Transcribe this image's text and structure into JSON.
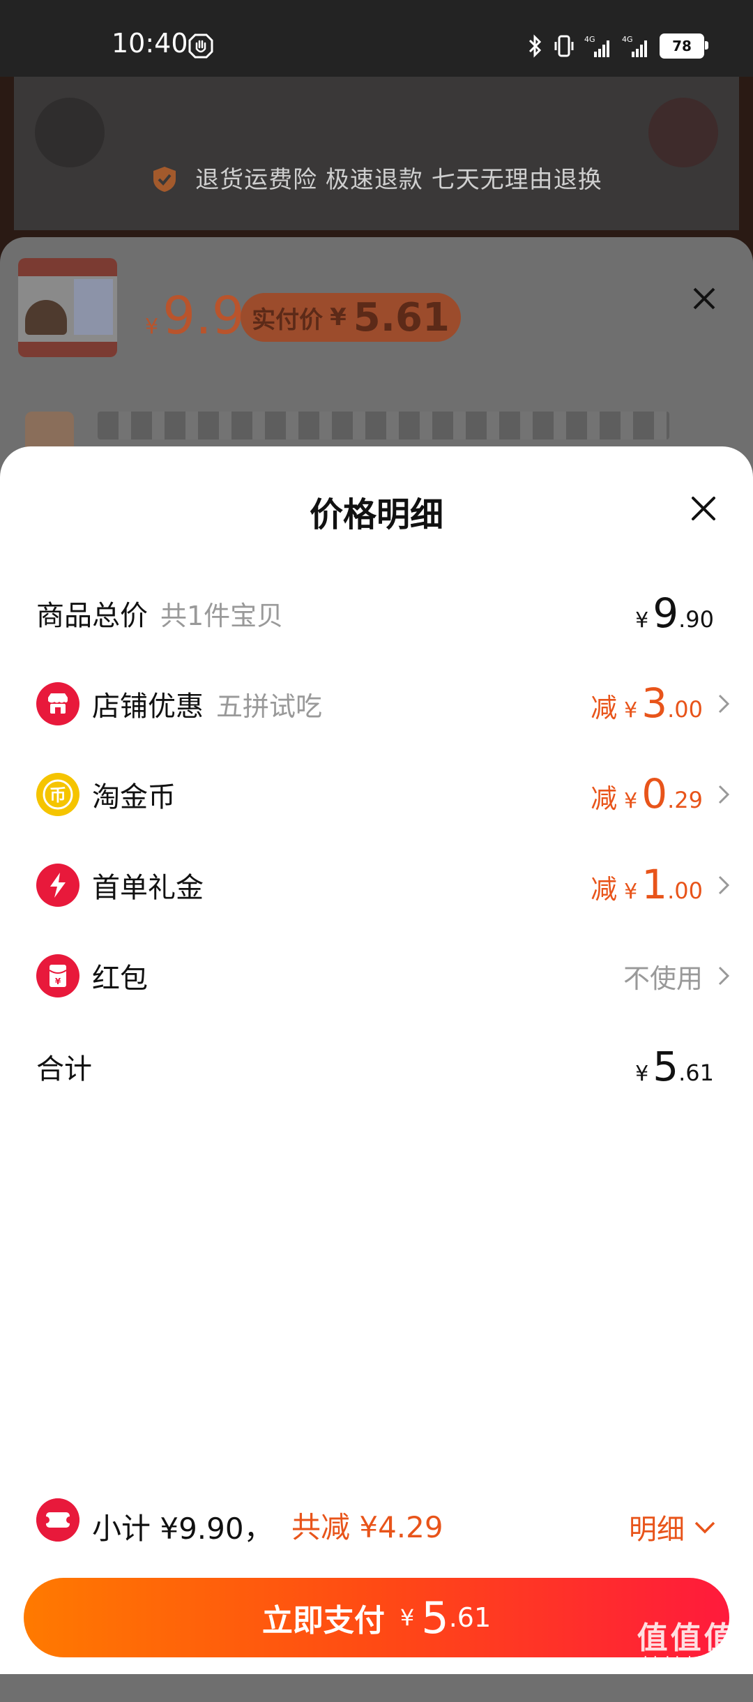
{
  "status_bar": {
    "time": "10:40",
    "battery": "78",
    "network_1": "4G",
    "network_2": "4G"
  },
  "background": {
    "guarantee_text": "退货运费险 极速退款 七天无理由退换",
    "sku_price_symbol": "¥",
    "sku_price": "9.9",
    "sku_actual_pay_label": "实付价",
    "sku_actual_pay_symbol": "¥",
    "sku_actual_pay_value": "5.61"
  },
  "sheet": {
    "title": "价格明细",
    "rows": [
      {
        "label": "商品总价",
        "sub": "共1件宝贝",
        "icon": "none",
        "prefix": "",
        "currency": "¥",
        "int": "9",
        "dec": ".90",
        "color": "black"
      },
      {
        "label": "店铺优惠",
        "sub": "五拼试吃",
        "icon": "store-icon",
        "prefix": "减",
        "currency": "¥",
        "int": "3",
        "dec": ".00",
        "color": "orange"
      },
      {
        "label": "淘金币",
        "sub": "",
        "icon": "gold-coin-icon",
        "prefix": "减",
        "currency": "¥",
        "int": "0",
        "dec": ".29",
        "color": "orange"
      },
      {
        "label": "首单礼金",
        "sub": "",
        "icon": "lightning-icon",
        "prefix": "减",
        "currency": "¥",
        "int": "1",
        "dec": ".00",
        "color": "orange"
      },
      {
        "label": "红包",
        "sub": "",
        "icon": "red-packet-icon",
        "value_text": "不使用"
      },
      {
        "label": "合计",
        "sub": "",
        "icon": "none",
        "currency": "¥",
        "int": "5",
        "dec": ".61",
        "color": "black"
      }
    ],
    "subtotal_text": "小计 ¥9.90，",
    "subtotal_reduce": "共减 ¥4.29",
    "detail_label": "明细"
  },
  "pay_button": {
    "label": "立即支付",
    "currency": "¥",
    "int": "5",
    "dec": ".61"
  },
  "watermark": {
    "big": "值值值",
    "small": "zhizhizhi.com"
  },
  "colors": {
    "accent_orange": "#e8541a",
    "pay_gradient_start": "#ff7a00",
    "pay_gradient_end": "#ff1a3c",
    "store_icon_red": "#e8193b",
    "coin_gold": "#f5c400"
  }
}
